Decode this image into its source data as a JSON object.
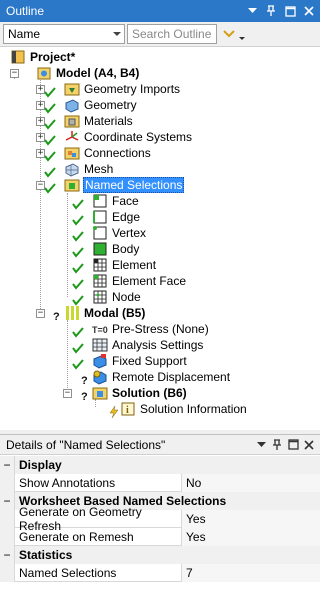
{
  "outline_panel": {
    "title": "Outline",
    "filter_combo": "Name",
    "search_placeholder": "Search Outline"
  },
  "tree": {
    "project": "Project*",
    "model": "Model (A4, B4)",
    "geometry_imports": "Geometry Imports",
    "geometry": "Geometry",
    "materials": "Materials",
    "coordinate_systems": "Coordinate Systems",
    "connections": "Connections",
    "mesh": "Mesh",
    "named_selections": "Named Selections",
    "ns_items": [
      "Face",
      "Edge",
      "Vertex",
      "Body",
      "Element",
      "Element Face",
      "Node"
    ],
    "modal": "Modal (B5)",
    "pre_stress": "Pre-Stress (None)",
    "analysis_settings": "Analysis Settings",
    "fixed_support": "Fixed Support",
    "remote_displacement": "Remote Displacement",
    "solution": "Solution (B6)",
    "solution_information": "Solution Information"
  },
  "details": {
    "title": "Details of \"Named Selections\"",
    "cat_display": "Display",
    "show_annotations_label": "Show Annotations",
    "show_annotations_value": "No",
    "cat_worksheet": "Worksheet Based Named Selections",
    "gen_refresh_label": "Generate on Geometry Refresh",
    "gen_refresh_value": "Yes",
    "gen_remesh_label": "Generate on Remesh",
    "gen_remesh_value": "Yes",
    "cat_statistics": "Statistics",
    "named_selections_label": "Named Selections",
    "named_selections_value": "7",
    "expander_symbol": "−"
  },
  "colors": {
    "titlebar": "#2b78c8",
    "selection": "#3390ff",
    "check_green": "#1a9a1a"
  }
}
